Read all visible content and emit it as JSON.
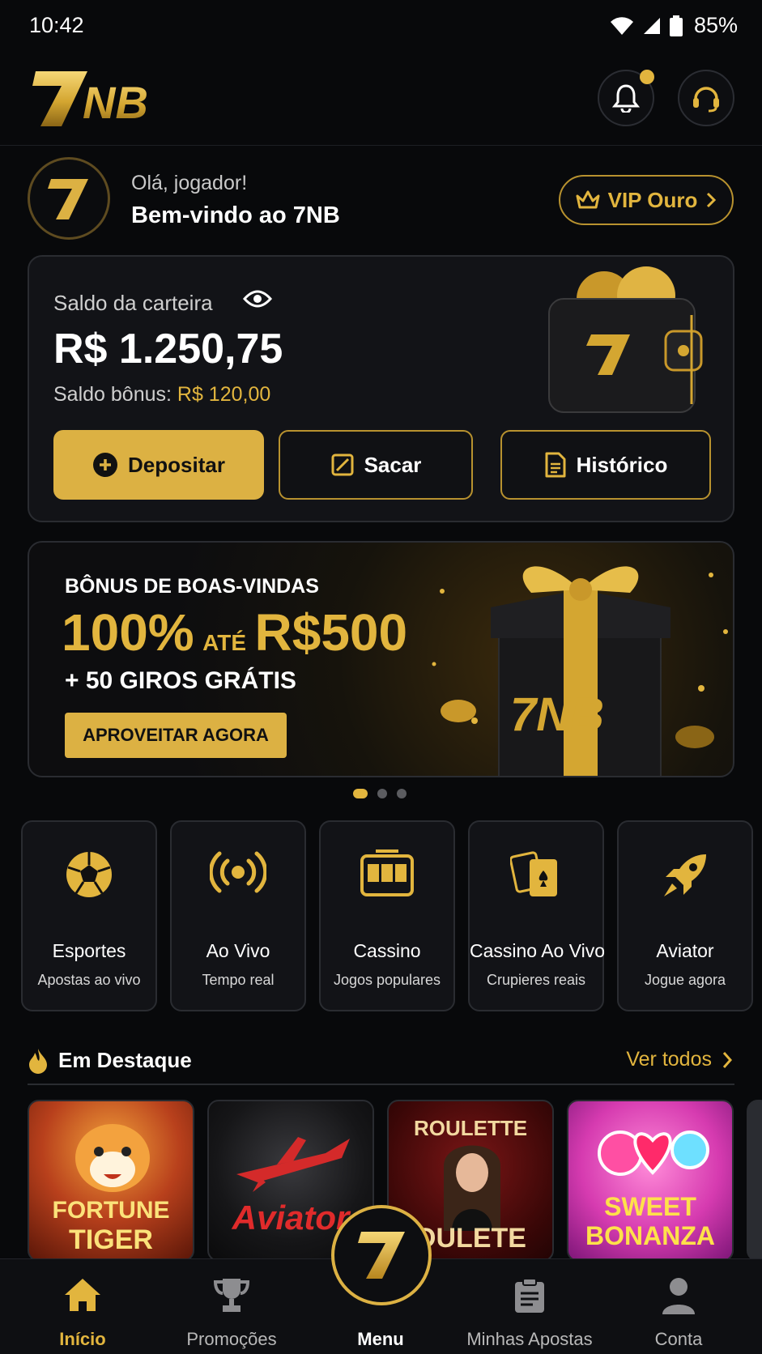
{
  "status_bar": {
    "time": "10:42",
    "battery": "85%"
  },
  "header": {
    "logo_text": "7NB"
  },
  "greeting": {
    "line1": "Olá, jogador!",
    "line2": "Bem-vindo ao 7NB",
    "vip_label": "VIP Ouro"
  },
  "wallet": {
    "label": "Saldo da carteira",
    "balance": "R$ 1.250,75",
    "bonus_label": "Saldo bônus:",
    "bonus_value": "R$ 120,00",
    "deposit": "Depositar",
    "withdraw": "Sacar",
    "history": "Histórico"
  },
  "banner": {
    "kicker": "BÔNUS DE BOAS-VINDAS",
    "percent": "100%",
    "until": "ATÉ",
    "amount": "R$500",
    "extra": "+ 50 GIROS GRÁTIS",
    "cta": "APROVEITAR AGORA",
    "active_slide": 1,
    "slides": 3
  },
  "categories": [
    {
      "title": "Esportes",
      "subtitle": "Apostas ao vivo",
      "icon": "soccer-ball-icon"
    },
    {
      "title": "Ao Vivo",
      "subtitle": "Tempo real",
      "icon": "broadcast-icon"
    },
    {
      "title": "Cassino",
      "subtitle": "Jogos populares",
      "icon": "slot-machine-icon"
    },
    {
      "title": "Cassino Ao Vivo",
      "subtitle": "Crupieres reais",
      "icon": "playing-cards-icon"
    },
    {
      "title": "Aviator",
      "subtitle": "Jogue agora",
      "icon": "rocket-icon"
    }
  ],
  "featured": {
    "title": "Em Destaque",
    "see_all": "Ver todos",
    "games": [
      {
        "line1": "FORTUNE",
        "line2": "TIGER"
      },
      {
        "line1": "Aviator"
      },
      {
        "line1": "ROULETTE",
        "line2": "OULETE"
      },
      {
        "line1": "SWEET",
        "line2": "BONANZA"
      }
    ]
  },
  "nav": {
    "home": "Início",
    "promos": "Promoções",
    "menu": "Menu",
    "bets": "Minhas Apostas",
    "account": "Conta"
  },
  "colors": {
    "accent": "#e2b53e",
    "background": "#08090b",
    "card": "#121317"
  }
}
